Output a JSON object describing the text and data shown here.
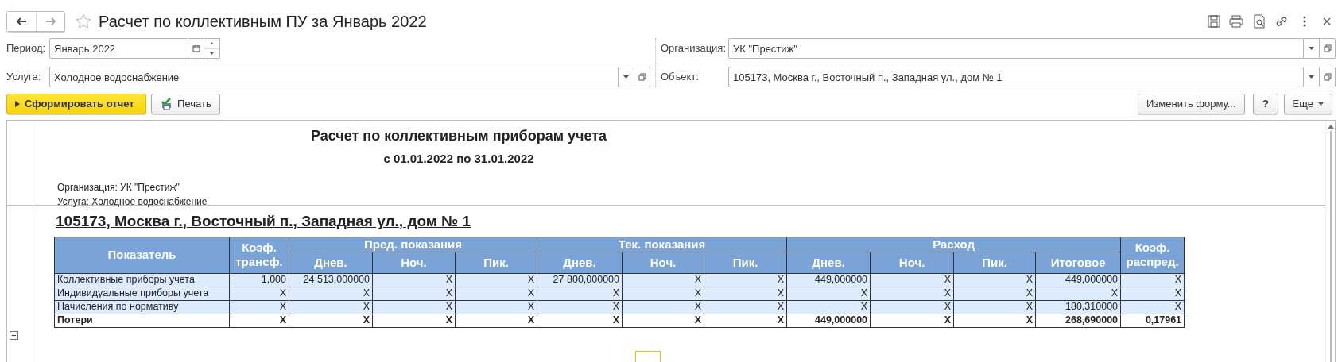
{
  "window": {
    "title": "Расчет по коллективным ПУ за Январь 2022",
    "favorite": false
  },
  "left_fields": [
    {
      "label": "Период:",
      "value": "Январь 2022",
      "kind": "period"
    },
    {
      "label": "Услуга:",
      "value": "Холодное водоснабжение",
      "kind": "select"
    }
  ],
  "right_fields": [
    {
      "label": "Организация:",
      "value": "УК \"Престиж\"",
      "kind": "select"
    },
    {
      "label": "Объект:",
      "value": "105173, Москва г., Восточный п., Западная ул., дом № 1",
      "kind": "select"
    }
  ],
  "buttons": [
    {
      "label": "Сформировать отчет",
      "kind": "primary"
    },
    {
      "label": "Печать",
      "kind": "print"
    }
  ],
  "right_buttons": [
    {
      "label": "Изменить форму...",
      "kind": "plain"
    },
    {
      "label": "?",
      "kind": "help"
    },
    {
      "label": "Еще",
      "kind": "menu"
    }
  ],
  "report": {
    "title": "Расчет по коллективным приборам учета",
    "subtitle": "с 01.01.2022 по 31.01.2022",
    "info": [
      "Организация: УК \"Престиж\"",
      "Услуга: Холодное водоснабжение"
    ],
    "object": "105173, Москва г., Восточный п., Западная ул., дом № 1",
    "table": {
      "columns": [
        {
          "label": "Показатель"
        },
        {
          "label": "Коэф. трансф."
        },
        {
          "label": "Пред. показания",
          "colspan": 3,
          "sub": [
            "Днев.",
            "Ноч.",
            "Пик."
          ]
        },
        {
          "label": "Тек. показания",
          "colspan": 3,
          "sub": [
            "Днев.",
            "Ноч.",
            "Пик."
          ]
        },
        {
          "label": "Расход",
          "colspan": 4,
          "sub": [
            "Днев.",
            "Ноч.",
            "Пик.",
            "Итоговое"
          ]
        },
        {
          "label": "Коэф. распред."
        }
      ],
      "rows": [
        {
          "total": false,
          "cells": [
            "Коллективные приборы учета",
            "1,000",
            "24 513,000000",
            "X",
            "X",
            "27 800,000000",
            "X",
            "X",
            "449,000000",
            "X",
            "X",
            "449,000000",
            "X"
          ]
        },
        {
          "total": false,
          "cells": [
            "Индивидуальные приборы учета",
            "X",
            "X",
            "X",
            "X",
            "X",
            "X",
            "X",
            "X",
            "X",
            "X",
            "X",
            "X"
          ]
        },
        {
          "total": false,
          "cells": [
            "Начисления по нормативу",
            "X",
            "X",
            "X",
            "X",
            "X",
            "X",
            "X",
            "X",
            "X",
            "X",
            "180,310000",
            "X"
          ]
        },
        {
          "total": true,
          "cells": [
            "Потери",
            "X",
            "X",
            "X",
            "X",
            "X",
            "X",
            "X",
            "449,000000",
            "X",
            "X",
            "268,690000",
            "0,17961"
          ]
        }
      ]
    }
  }
}
